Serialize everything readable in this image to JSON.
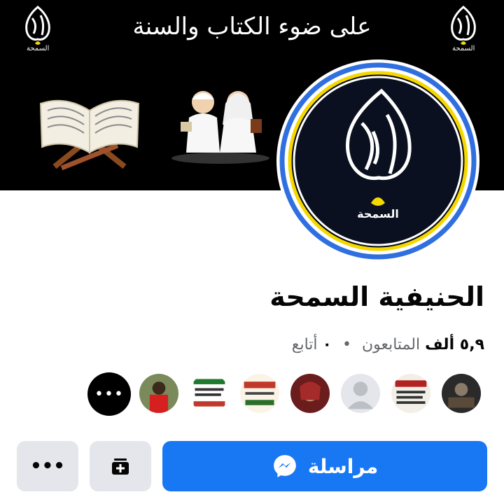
{
  "cover": {
    "title": "على ضوء الكتاب والسنة",
    "logo_caption": "السمحة"
  },
  "profile": {
    "avatar_caption": "السمحة",
    "name": "الحنيفية السمحة",
    "followers_count": "٥,٩ ألف",
    "followers_label": "المتابعون",
    "following_count": "٠",
    "following_label": "أتابع",
    "separator": "•"
  },
  "friends": {
    "more_label": "•••"
  },
  "actions": {
    "message_label": "مراسلة",
    "more_label": "•••"
  },
  "colors": {
    "accent": "#1877f2",
    "button_grey": "#e4e6eb",
    "avatar_ring": "#2f6fe0",
    "logo_gold": "#f5d800"
  },
  "icons": {
    "message": "messenger-icon",
    "follow": "follow-add-icon",
    "more": "more-dots-icon"
  }
}
